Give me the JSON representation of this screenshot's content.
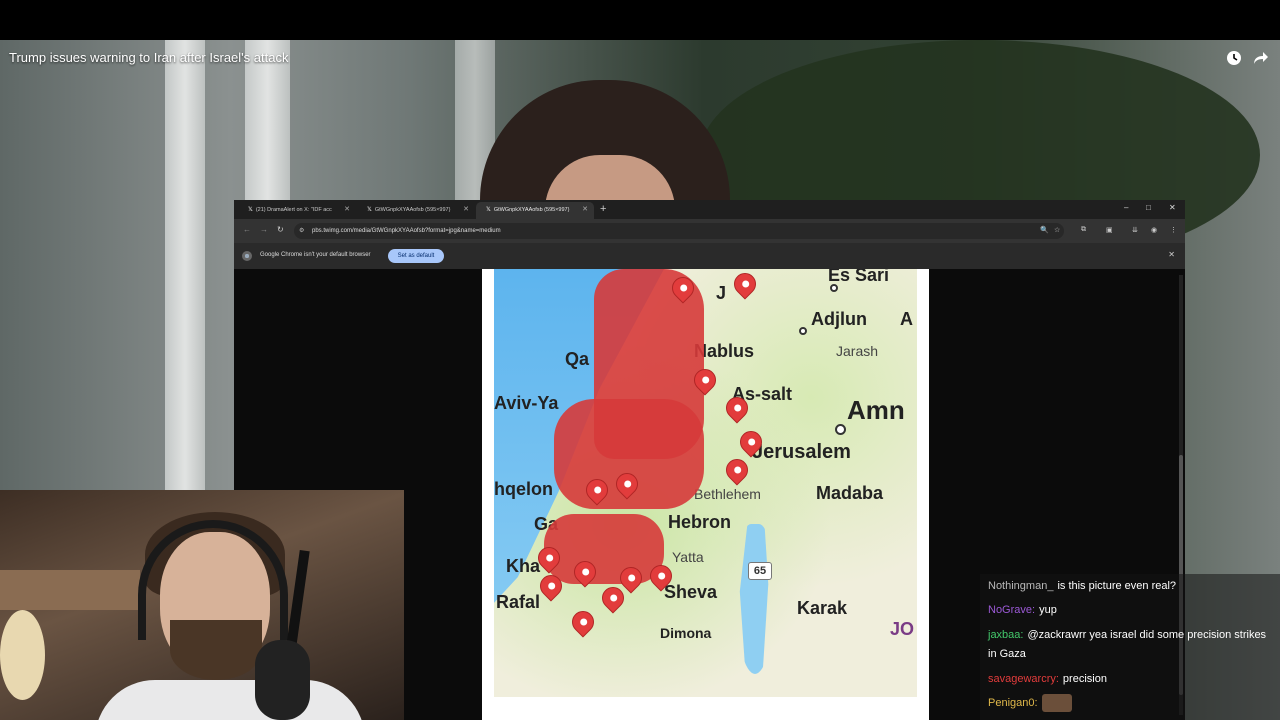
{
  "video": {
    "title": "Trump issues warning to Iran after Israel's attack",
    "icons": [
      "clock-icon",
      "share-icon"
    ]
  },
  "browser": {
    "tabs": [
      {
        "label": "(21) DramaAlert on X: \"IDF acc",
        "active": false
      },
      {
        "label": "GtWGnpkXYAAofsb (595×997)",
        "active": false
      },
      {
        "label": "GtWGnpkXYAAofsb (595×997)",
        "active": true
      }
    ],
    "url": "pbs.twimg.com/media/GtWGnpkXYAAofsb?format=jpg&name=medium",
    "infobar": {
      "message": "Google Chrome isn't your default browser",
      "button": "Set as default"
    }
  },
  "map": {
    "places": {
      "es_sari": "Es Sari",
      "ajlun": "Adjlun",
      "a": "A",
      "jarash": "Jarash",
      "nablus": "Nablus",
      "qa": "Qa",
      "aviv": "Aviv-Ya",
      "as_salt": "As-salt",
      "amman": "Amn",
      "jerusalem": "Jerusalem",
      "bethlehem": "Bethlehem",
      "madaba": "Madaba",
      "ashkelon": "hqelon",
      "ga": "Ga",
      "hebron": "Hebron",
      "yatta": "Yatta",
      "kha": "Kha",
      "rafah": "Rafal",
      "sheva": "Sheva",
      "karak": "Karak",
      "dimona": "Dimona",
      "jo": "JO",
      "j": "J"
    },
    "road_number": "65"
  },
  "chat": [
    {
      "user": "Nothingman_",
      "message": "is this picture even real?",
      "color": "#b8b8b8"
    },
    {
      "user": "NoGrave:",
      "message": "yup",
      "color": "#9b59d6"
    },
    {
      "user": "jaxbaa:",
      "message": "@zackrawrr yea israel did some precision strikes",
      "color": "#43c86b"
    },
    {
      "user": "",
      "message": "in Gaza",
      "color": "#ffffff"
    },
    {
      "user": "savagewarcry:",
      "message": "precision",
      "color": "#e23c3c"
    },
    {
      "user": "Penigan0:",
      "message": "",
      "color": "#e0b84a"
    }
  ]
}
